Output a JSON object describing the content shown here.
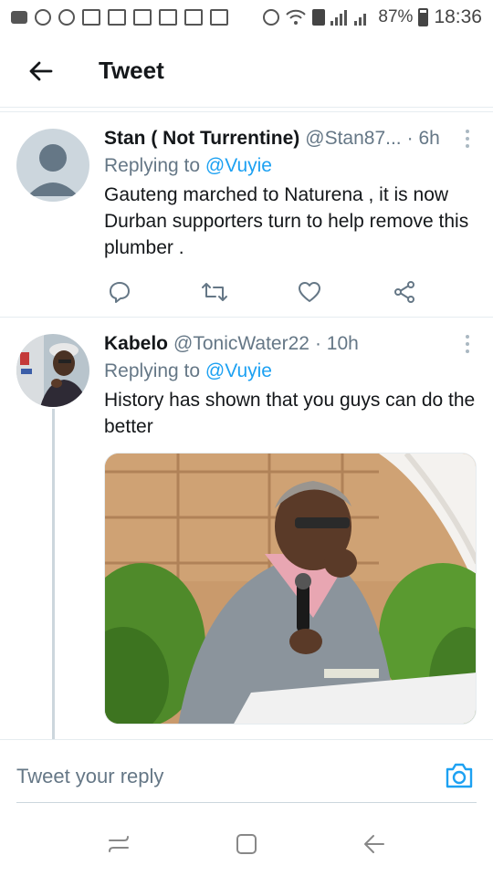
{
  "status_bar": {
    "battery": "87%",
    "time": "18:36",
    "left_icons": [
      "message-icon",
      "whatsapp-icon",
      "chat-icon",
      "gmail-icon",
      "gmail-icon",
      "gmail-icon",
      "gallery-icon",
      "checkbox-icon",
      "image-icon"
    ],
    "right_icons": [
      "alarm-icon",
      "wifi-icon",
      "sim-icon",
      "signal-icon",
      "signal-icon",
      "battery-icon"
    ]
  },
  "header": {
    "title": "Tweet"
  },
  "tweets": [
    {
      "name": "Stan ( Not Turrentine)",
      "handle": "@Stan87...",
      "time": "· 6h",
      "replying_prefix": "Replying to ",
      "replying_to": "@Vuyie",
      "text": "Gauteng marched to Naturena , it is now Durban supporters turn to help remove this plumber ."
    },
    {
      "name": "Kabelo",
      "handle": "@TonicWater22",
      "time": "· 10h",
      "replying_prefix": "Replying to ",
      "replying_to": "@Vuyie",
      "text": "History has shown that you guys can do the better"
    }
  ],
  "reply": {
    "placeholder": "Tweet your reply"
  },
  "colors": {
    "accent": "#1da1f2",
    "secondary_text": "#657786",
    "divider": "#e6ecf0"
  }
}
